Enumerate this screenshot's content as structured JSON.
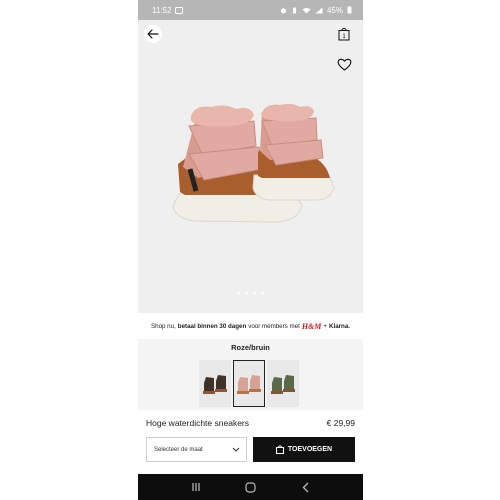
{
  "status_bar": {
    "time": "11:52",
    "battery": "45%",
    "icons": [
      "gallery-icon",
      "alarm-icon",
      "vibrate-icon",
      "wifi-icon",
      "signal-icon",
      "battery-icon"
    ]
  },
  "hero": {
    "icons": {
      "back": "arrow-left-icon",
      "bag": "shopping-bag-icon",
      "favorite": "heart-icon"
    },
    "bag_count": "1",
    "image_count": 4,
    "active_image": 1
  },
  "promo": {
    "prefix": "Shop nu,",
    "bold": "betaal binnen 30 dagen",
    "suffix": "voor members met",
    "brand": "H&M",
    "plus": "+",
    "partner": "Klarna."
  },
  "product": {
    "color_name": "Roze/bruin",
    "variants": [
      {
        "upper": "#3f3329",
        "sole": "#8b5a34",
        "selected": false
      },
      {
        "upper": "#d8a196",
        "sole": "#b87447",
        "selected": true
      },
      {
        "upper": "#59694a",
        "sole": "#7e5737",
        "selected": false
      }
    ],
    "name": "Hoge waterdichte sneakers",
    "price": "€ 29,99"
  },
  "actions": {
    "size_placeholder": "Selecteer de maat",
    "add_label": "TOEVOEGEN"
  },
  "navigation": {
    "icons": [
      "recent-apps-icon",
      "home-icon",
      "back-icon"
    ]
  },
  "colors": {
    "accent_black": "#111111",
    "brand_red": "#d8121c",
    "status_gray": "#b6b6b6"
  }
}
